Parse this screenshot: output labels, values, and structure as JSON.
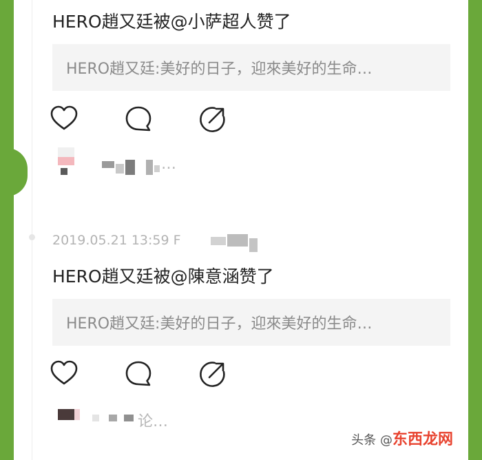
{
  "feed": [
    {
      "title": "HERO趙又廷被@小萨超人赞了",
      "quote": "HERO趙又廷:美好的日子，迎來美好的生命…",
      "liker_suffix": "…"
    },
    {
      "timestamp": "2019.05.21 13:59 F",
      "title": "HERO趙又廷被@陳意涵赞了",
      "quote": "HERO趙又廷:美好的日子，迎來美好的生命…",
      "liker_suffix": "论…"
    }
  ],
  "icons": {
    "like": "heart-icon",
    "comment": "comment-icon",
    "share": "share-icon"
  },
  "watermark": {
    "prefix": "头条 @",
    "brand": "东西龙网"
  },
  "colors": {
    "frame_green": "#6aa83a",
    "title_text": "#222222",
    "quote_bg": "#f4f4f4",
    "muted_text": "#8a8a8a",
    "watermark_accent": "#e8432f"
  }
}
